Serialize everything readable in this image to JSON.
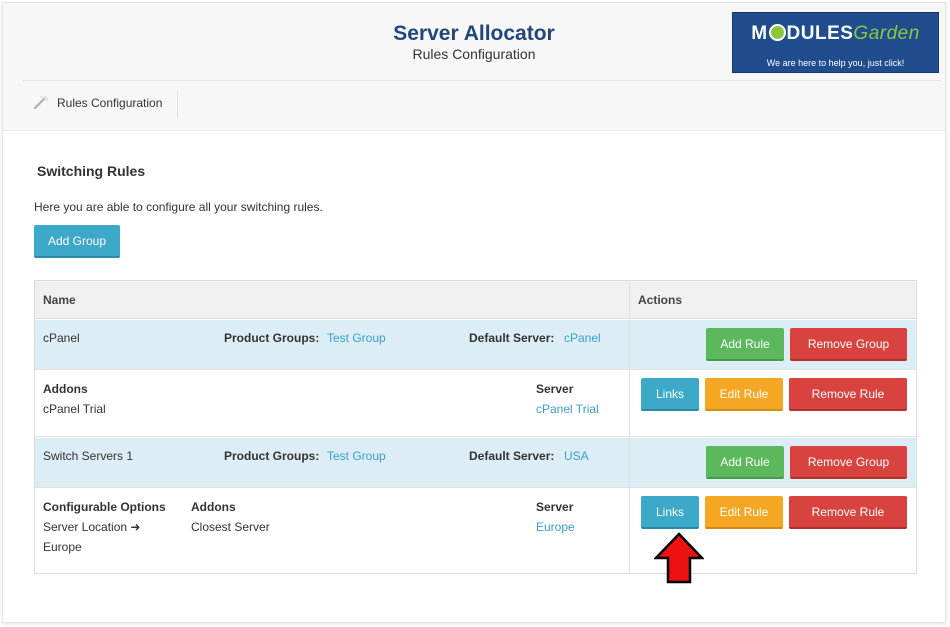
{
  "header": {
    "title": "Server Allocator",
    "subtitle": "Rules Configuration",
    "logo": {
      "text_part1": "M",
      "text_part2": "DULES",
      "text_part3": "Garden",
      "tagline": "We are here to help you, just click!"
    }
  },
  "nav": {
    "items": [
      {
        "label": "Rules Configuration",
        "icon": "wand-icon"
      }
    ]
  },
  "main": {
    "section_title": "Switching Rules",
    "description": "Here you are able to configure all your switching rules.",
    "add_group_label": "Add Group"
  },
  "table": {
    "headers": {
      "name": "Name",
      "actions": "Actions"
    },
    "groups": [
      {
        "name": "cPanel",
        "product_groups_label": "Product Groups:",
        "product_groups_value": "Test Group",
        "default_server_label": "Default Server:",
        "default_server_value": "cPanel",
        "add_rule_label": "Add Rule",
        "remove_group_label": "Remove Group",
        "rule": {
          "addons_label": "Addons",
          "addons_value": "cPanel Trial",
          "server_label": "Server",
          "server_value": "cPanel Trial",
          "links_label": "Links",
          "edit_label": "Edit Rule",
          "remove_label": "Remove Rule"
        }
      },
      {
        "name": "Switch Servers 1",
        "product_groups_label": "Product Groups:",
        "product_groups_value": "Test Group",
        "default_server_label": "Default Server:",
        "default_server_value": "USA",
        "add_rule_label": "Add Rule",
        "remove_group_label": "Remove Group",
        "rule": {
          "config_label": "Configurable Options",
          "config_value_1": "Server Location",
          "config_value_2": "Europe",
          "addons_label": "Addons",
          "addons_value": "Closest Server",
          "server_label": "Server",
          "server_value": "Europe",
          "links_label": "Links",
          "edit_label": "Edit Rule",
          "remove_label": "Remove Rule"
        }
      }
    ]
  },
  "colors": {
    "title": "#21477a",
    "link": "#3aa0d0",
    "group_row": "#dcedf5",
    "btn_blue": "#3da9c9",
    "btn_green": "#5cb85c",
    "btn_orange": "#f5a623",
    "btn_red": "#d9433f",
    "arrow": "#ee1111"
  }
}
